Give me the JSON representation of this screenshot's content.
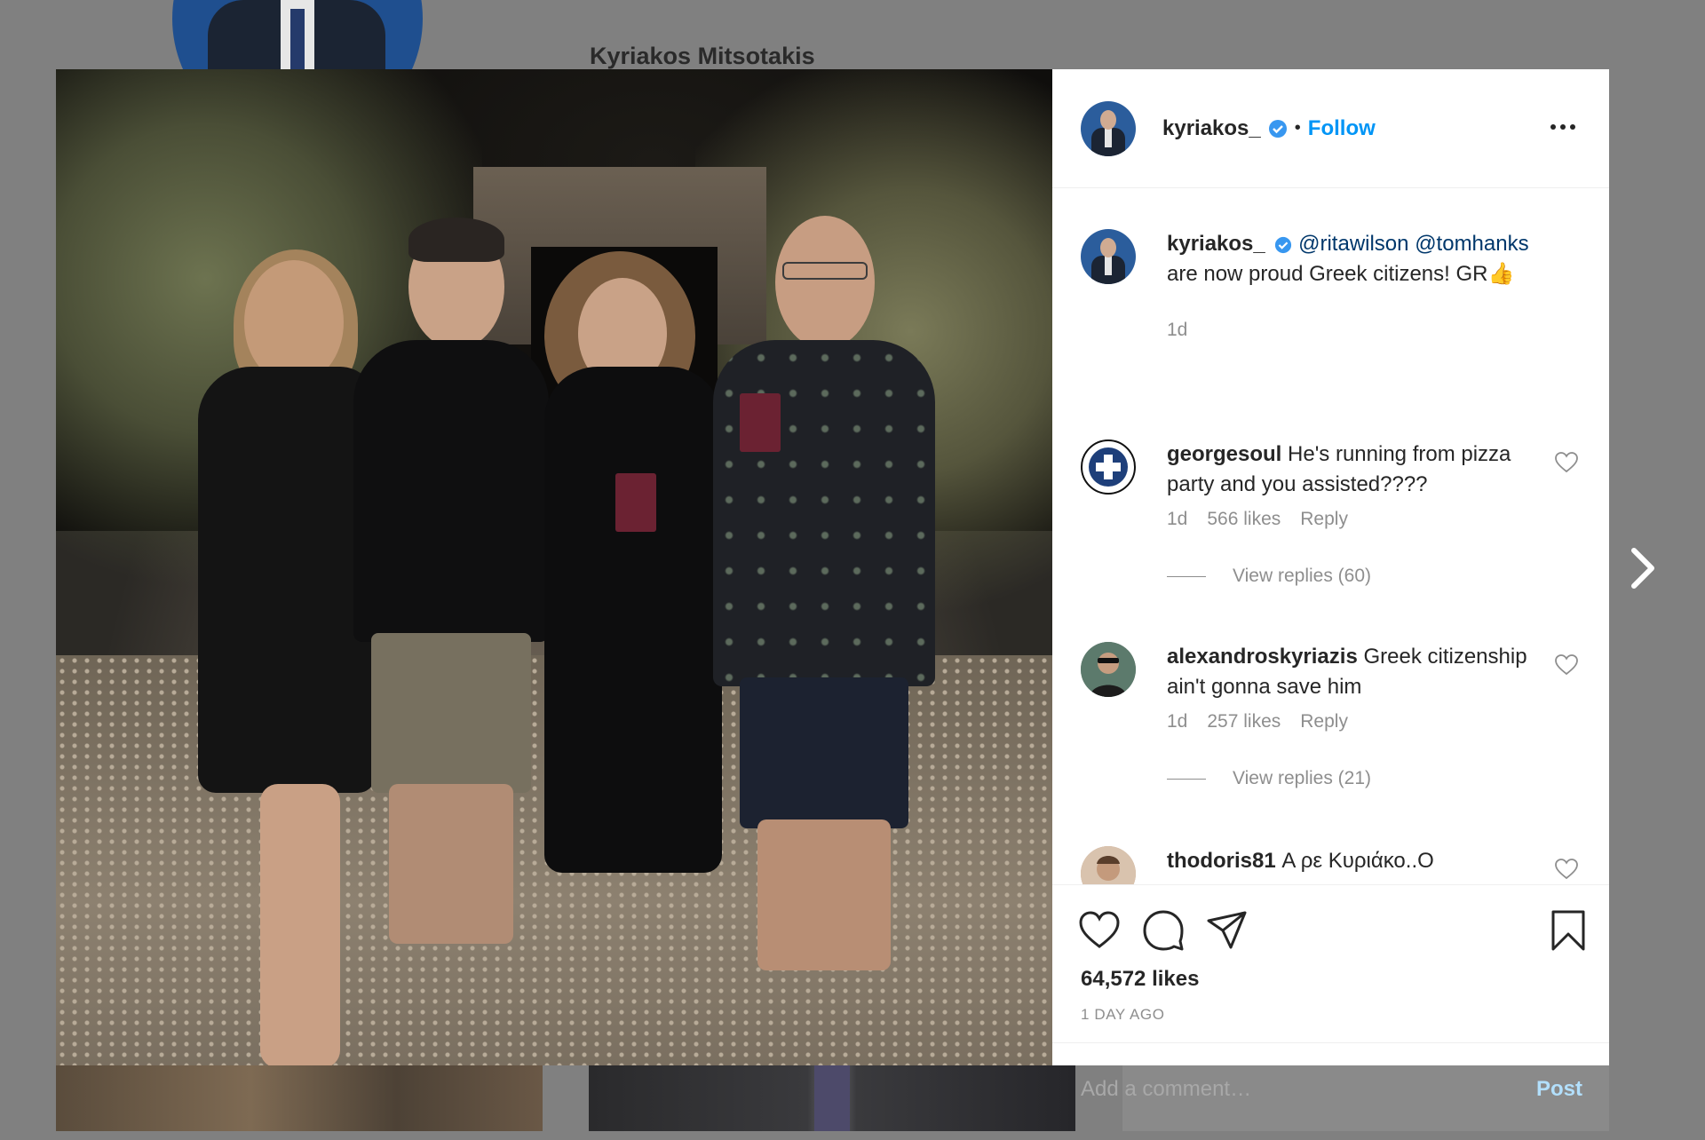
{
  "background": {
    "profile_name": "Kyriakos Mitsotakis",
    "subtitle_partial": "",
    "date_partial": ""
  },
  "post": {
    "username": "kyriakos_",
    "follow_label": "Follow",
    "separator": "•",
    "verified_icon": "verified-badge-icon",
    "caption": {
      "username": "kyriakos_",
      "mention1": "@ritawilson",
      "mention2": "@tomhanks",
      "text": "are now proud Greek citizens! GR👍",
      "time": "1d"
    },
    "comments": [
      {
        "username": "georgesoul",
        "text": "He's running from pizza party and you assisted????",
        "time": "1d",
        "likes": "566 likes",
        "reply": "Reply",
        "view_replies": "View replies (60)"
      },
      {
        "username": "alexandroskyriazis",
        "text": "Greek citizenship ain't gonna save him",
        "time": "1d",
        "likes": "257 likes",
        "reply": "Reply",
        "view_replies": "View replies (21)"
      },
      {
        "username": "thodoris81",
        "text": "Α ρε Κυριάκο..Ο"
      }
    ],
    "like_count": "64,572 likes",
    "posted": "1 DAY AGO",
    "add_comment_placeholder": "Add a comment…",
    "post_label": "Post"
  },
  "colors": {
    "link_blue": "#0095f6",
    "muted": "#8e8e8e",
    "overlay": "#808080"
  }
}
